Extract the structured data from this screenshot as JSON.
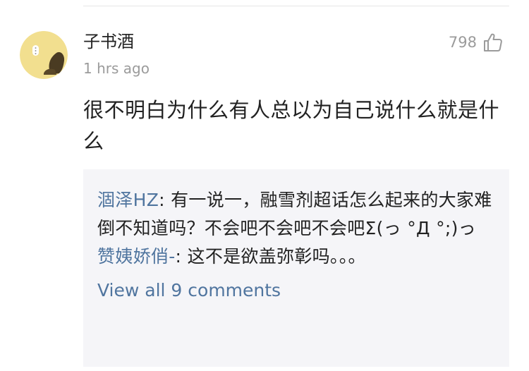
{
  "comment": {
    "username": "子书酒",
    "timestamp": "1 hrs ago",
    "like_count": "798",
    "text": "很不明白为什么有人总以为自己说什么就是什么"
  },
  "replies": [
    {
      "author": "涸泽HZ",
      "separator": ": ",
      "text": "有一说一，融雪剂超话怎么起来的大家难倒不知道吗？不会吧不会吧不会吧Σ(っ °Д °;)っ"
    },
    {
      "author": "赞姨娇俏-",
      "separator": ": ",
      "text": "这不是欲盖弥彰吗。。。"
    }
  ],
  "view_all_label": "View all 9 comments",
  "colors": {
    "link_blue": "#50759f",
    "text_primary": "#222222",
    "text_secondary": "#9b9b9b",
    "reply_background": "#f5f5f8",
    "avatar_background": "#f2df8f"
  },
  "icons": {
    "like": "thumbs-up-icon"
  }
}
